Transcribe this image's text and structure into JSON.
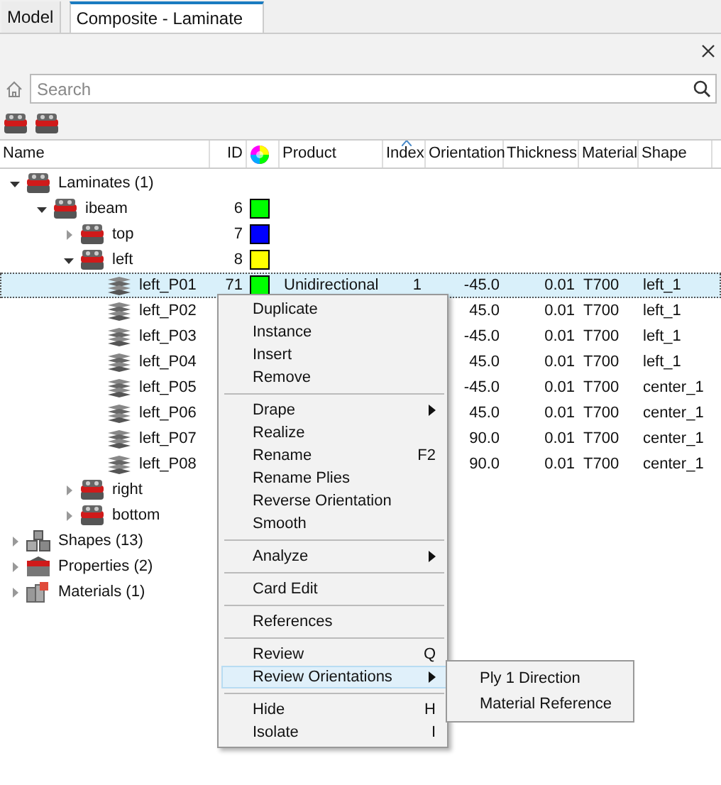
{
  "tabs": [
    {
      "label": "Model",
      "selected": false
    },
    {
      "label": "Composite - Laminate",
      "selected": true
    }
  ],
  "search": {
    "placeholder": "Search"
  },
  "table": {
    "columns": [
      {
        "kind": "text",
        "label": "Name"
      },
      {
        "kind": "text",
        "label": "ID"
      },
      {
        "kind": "color-wheel"
      },
      {
        "kind": "text",
        "label": "Product"
      },
      {
        "kind": "text",
        "label": "Index"
      },
      {
        "kind": "text",
        "label": "Orientation"
      },
      {
        "kind": "text",
        "label": "Thickness"
      },
      {
        "kind": "text",
        "label": "Material"
      },
      {
        "kind": "text",
        "label": "Shape"
      }
    ],
    "tree": [
      {
        "name": "Laminates (1)",
        "kind": "laminate",
        "expanded": true,
        "selected": false,
        "children": [
          {
            "name": "ibeam",
            "kind": "laminate",
            "id": "6",
            "color": "#00ff00",
            "expanded": true,
            "selected": false,
            "children": [
              {
                "name": "top",
                "kind": "laminate",
                "id": "7",
                "color": "#0000ff",
                "expanded": false,
                "selected": false
              },
              {
                "name": "left",
                "kind": "laminate",
                "id": "8",
                "color": "#ffff00",
                "expanded": true,
                "selected": false,
                "children": [
                  {
                    "name": "left_P01",
                    "kind": "ply",
                    "id": "71",
                    "color": "#00ff00",
                    "product": "Unidirectional",
                    "index": "1",
                    "orientation": "-45.0",
                    "thickness": "0.01",
                    "material": "T700",
                    "shape": "left_1",
                    "selected": true
                  },
                  {
                    "name": "left_P02",
                    "kind": "ply",
                    "orientation": "45.0",
                    "thickness": "0.01",
                    "material": "T700",
                    "shape": "left_1",
                    "selected": false
                  },
                  {
                    "name": "left_P03",
                    "kind": "ply",
                    "orientation": "-45.0",
                    "thickness": "0.01",
                    "material": "T700",
                    "shape": "left_1",
                    "selected": false
                  },
                  {
                    "name": "left_P04",
                    "kind": "ply",
                    "orientation": "45.0",
                    "thickness": "0.01",
                    "material": "T700",
                    "shape": "left_1",
                    "selected": false
                  },
                  {
                    "name": "left_P05",
                    "kind": "ply",
                    "orientation": "-45.0",
                    "thickness": "0.01",
                    "material": "T700",
                    "shape": "center_1",
                    "selected": false
                  },
                  {
                    "name": "left_P06",
                    "kind": "ply",
                    "orientation": "45.0",
                    "thickness": "0.01",
                    "material": "T700",
                    "shape": "center_1",
                    "selected": false
                  },
                  {
                    "name": "left_P07",
                    "kind": "ply",
                    "orientation": "90.0",
                    "thickness": "0.01",
                    "material": "T700",
                    "shape": "center_1",
                    "selected": false
                  },
                  {
                    "name": "left_P08",
                    "kind": "ply",
                    "orientation": "90.0",
                    "thickness": "0.01",
                    "material": "T700",
                    "shape": "center_1",
                    "selected": false
                  }
                ]
              },
              {
                "name": "right",
                "kind": "laminate",
                "expanded": false,
                "selected": false
              },
              {
                "name": "bottom",
                "kind": "laminate",
                "expanded": false,
                "selected": false
              }
            ]
          }
        ]
      },
      {
        "name": "Shapes (13)",
        "kind": "shapes",
        "expanded": false,
        "selected": false
      },
      {
        "name": "Properties (2)",
        "kind": "properties",
        "expanded": false,
        "selected": false
      },
      {
        "name": "Materials (1)",
        "kind": "materials",
        "expanded": false,
        "selected": false
      }
    ]
  },
  "context_menu": [
    {
      "kind": "item",
      "label": "Duplicate",
      "selected": false
    },
    {
      "kind": "item",
      "label": "Instance",
      "selected": false
    },
    {
      "kind": "item",
      "label": "Insert",
      "selected": false
    },
    {
      "kind": "item",
      "label": "Remove",
      "selected": false
    },
    {
      "kind": "separator"
    },
    {
      "kind": "item",
      "label": "Drape",
      "submenu": true,
      "selected": false
    },
    {
      "kind": "item",
      "label": "Realize",
      "selected": false
    },
    {
      "kind": "item",
      "label": "Rename",
      "shortcut": "F2",
      "selected": false
    },
    {
      "kind": "item",
      "label": "Rename Plies",
      "selected": false
    },
    {
      "kind": "item",
      "label": "Reverse Orientation",
      "selected": false
    },
    {
      "kind": "item",
      "label": "Smooth",
      "selected": false
    },
    {
      "kind": "separator"
    },
    {
      "kind": "item",
      "label": "Analyze",
      "submenu": true,
      "selected": false
    },
    {
      "kind": "separator"
    },
    {
      "kind": "item",
      "label": "Card Edit",
      "selected": false
    },
    {
      "kind": "separator"
    },
    {
      "kind": "item",
      "label": "References",
      "selected": false
    },
    {
      "kind": "separator"
    },
    {
      "kind": "item",
      "label": "Review",
      "shortcut": "Q",
      "selected": false
    },
    {
      "kind": "item",
      "label": "Review Orientations",
      "submenu": true,
      "selected": true,
      "items": [
        "Ply 1 Direction",
        "Material Reference"
      ]
    },
    {
      "kind": "separator"
    },
    {
      "kind": "item",
      "label": "Hide",
      "shortcut": "H",
      "selected": false
    },
    {
      "kind": "item",
      "label": "Isolate",
      "shortcut": "I",
      "selected": false
    }
  ]
}
